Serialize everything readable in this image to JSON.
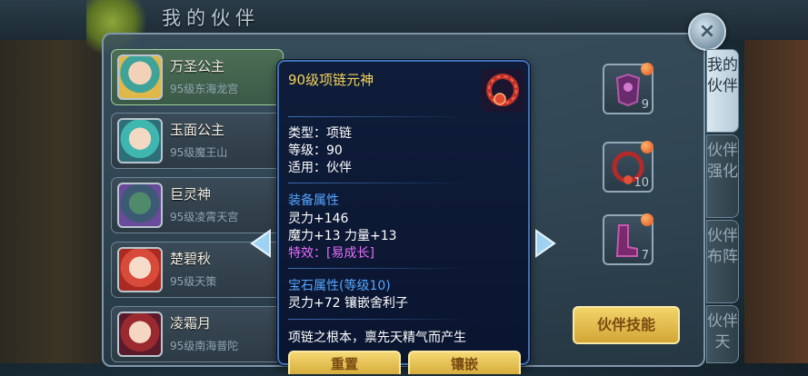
{
  "window": {
    "title": "我的伙伴",
    "close_label": "×"
  },
  "partners": [
    {
      "name": "万圣公主",
      "subtitle": "95级东海龙宫"
    },
    {
      "name": "玉面公主",
      "subtitle": "95级魔王山"
    },
    {
      "name": "巨灵神",
      "subtitle": "95级凌霄天宫"
    },
    {
      "name": "楚碧秋",
      "subtitle": "95级天策"
    },
    {
      "name": "凌霜月",
      "subtitle": "95级南海普陀"
    }
  ],
  "equipment_slots": [
    {
      "count": "9"
    },
    {
      "count": "10"
    },
    {
      "count": "7"
    }
  ],
  "side_tabs": [
    {
      "label": "我的伙伴"
    },
    {
      "label": "伙伴强化"
    },
    {
      "label": "伙伴布阵"
    },
    {
      "label": "伙伴天"
    }
  ],
  "skill_button": "伙伴技能",
  "tooltip": {
    "title": "90级项链元神",
    "basic": [
      "类型：项链",
      "等级：90",
      "适用：伙伴"
    ],
    "equip_header": "装备属性",
    "equip_stats": [
      "灵力+146",
      "魔力+13 力量+13"
    ],
    "special": "特效：[易成长]",
    "gem_header": "宝石属性(等级10)",
    "gem_stats": [
      "灵力+72 镶嵌舍利子"
    ],
    "description": "项链之根本，禀先天精气而产生",
    "buttons": [
      "重置",
      "镶嵌"
    ]
  },
  "colors": {
    "title_gold": "#f4d45a",
    "attr_blue": "#56a6ff",
    "special_pink": "#e86cff",
    "button_gold": "#e8c255"
  }
}
